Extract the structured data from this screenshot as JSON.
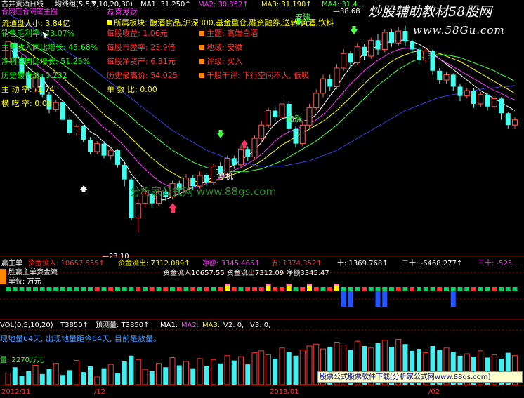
{
  "colors": {
    "bg": "#000000",
    "up": "#ff5a5a",
    "down": "#44ffee",
    "ma1": "#ffffff",
    "ma2": "#ff33ff",
    "ma3": "#ffff00",
    "ma4": "#44ff44",
    "ma5": "#3a3ad8",
    "panel_red": "#ff3030",
    "yellow": "#ffff00",
    "green": "#00ff00",
    "magenta": "#ff33ff",
    "cyan": "#44ffee",
    "white": "#ffffff",
    "bar_green": "#11cc66",
    "bar_red": "#ff3333",
    "bar_blue": "#2255ff",
    "bar_yellow": "#ffee00",
    "bar_pink": "#ff88bb",
    "vol_cyan": "#44eeee",
    "vol_red": "#ff3333"
  },
  "header": {
    "title": "古井贡酒日线",
    "indicator": "均线组(5,5,7,10,20,30)",
    "ma1": "MA1: 31.250↑",
    "ma2": "MA2: 30.852↑",
    "ma3": "MA3: 31.190↑",
    "ma4": "MA4: 31.4..."
  },
  "watermark": {
    "title": "炒股辅助教材58股网",
    "url": "www.58Gu.com",
    "center": "分析家公式网 www.88gs.com",
    "ad": "股票公式股票软件下载[分析家公式网www.88gs.com]"
  },
  "info_left": [
    {
      "label": "合网旺合鸡密主图",
      "color": "magenta"
    },
    {
      "label": "流通盘大小: 3.84亿",
      "color": "yellow"
    },
    {
      "label": "销售毛利率: 73.07%",
      "color": "green"
    },
    {
      "label": "主营收入同比增长: 45.68%",
      "color": "green"
    },
    {
      "label": "净利润同比增长: 51.25%",
      "color": "green"
    },
    {
      "label": "历史最低价: 0.232",
      "color": "green"
    },
    {
      "label": "主 动 率: -1.74",
      "color": "yellow"
    },
    {
      "label": "横 吃 率: 0.00",
      "color": "yellow"
    }
  ],
  "info_mid": [
    {
      "label": "恭喜发财",
      "color": "magenta"
    },
    {
      "label": "所属板块: 酿酒食品,沪深300,基金重仓,融资融券,送转,黄酒,饮料",
      "color": "yellow"
    },
    {
      "label": "每股收益: 1.06元",
      "color": "panel_red"
    },
    {
      "label": "每股市盈率: 23.9倍",
      "color": "panel_red"
    },
    {
      "label": "每股净资产: 6.31元",
      "color": "panel_red"
    },
    {
      "label": "历史最高价: 54.025",
      "color": "panel_red"
    },
    {
      "label": "单 数 比: 0.00",
      "color": "yellow"
    }
  ],
  "info_right": [
    {
      "label": "主题: 高端白酒",
      "color": "panel_red"
    },
    {
      "label": "地域: 安徽",
      "color": "panel_red"
    },
    {
      "label": "评级: 买入",
      "color": "panel_red"
    },
    {
      "label": "千股千评: 下行空间不大, 低吸",
      "color": "panel_red"
    }
  ],
  "annotations": {
    "high": "38.68",
    "low": "23.10",
    "anjian": "安建",
    "seek": "寻机",
    "chase": "追涨"
  },
  "chart_data": {
    "type": "candlestick",
    "ylim": [
      22,
      40
    ],
    "high_label": 38.68,
    "low_label": 23.1,
    "candles": [
      [
        36.0,
        37.5,
        35.8,
        37.8
      ],
      [
        37.4,
        36.3,
        36.0,
        37.6
      ],
      [
        36.3,
        35.1,
        34.9,
        36.5
      ],
      [
        35.1,
        34.0,
        33.8,
        35.3
      ],
      [
        34.0,
        34.8,
        33.7,
        35.0
      ],
      [
        34.8,
        33.5,
        33.3,
        35.0
      ],
      [
        33.5,
        32.4,
        32.1,
        33.7
      ],
      [
        32.4,
        32.9,
        32.2,
        33.1
      ],
      [
        32.9,
        31.6,
        31.4,
        33.0
      ],
      [
        31.6,
        30.6,
        30.4,
        31.8
      ],
      [
        30.6,
        31.1,
        30.4,
        31.3
      ],
      [
        31.1,
        30.1,
        29.9,
        31.2
      ],
      [
        30.1,
        29.2,
        29.0,
        30.3
      ],
      [
        29.2,
        29.8,
        29.0,
        30.0
      ],
      [
        29.8,
        28.9,
        28.7,
        30.0
      ],
      [
        28.9,
        29.3,
        28.6,
        29.5
      ],
      [
        29.3,
        28.2,
        28.0,
        29.4
      ],
      [
        28.2,
        27.1,
        26.6,
        28.4
      ],
      [
        27.1,
        24.2,
        24.0,
        27.2
      ],
      [
        24.2,
        25.3,
        23.1,
        25.6
      ],
      [
        25.3,
        26.0,
        25.0,
        26.2
      ],
      [
        26.0,
        25.3,
        25.0,
        26.2
      ],
      [
        25.3,
        26.2,
        25.1,
        26.5
      ],
      [
        26.2,
        25.8,
        25.5,
        26.4
      ],
      [
        25.8,
        26.8,
        25.6,
        27.0
      ],
      [
        26.8,
        26.3,
        26.0,
        27.0
      ],
      [
        26.3,
        27.2,
        26.1,
        27.5
      ],
      [
        27.2,
        26.6,
        26.3,
        27.4
      ],
      [
        26.6,
        27.4,
        26.4,
        27.7
      ],
      [
        27.4,
        26.9,
        26.6,
        27.6
      ],
      [
        26.9,
        28.1,
        26.7,
        28.3
      ],
      [
        28.1,
        27.5,
        27.2,
        28.4
      ],
      [
        27.5,
        28.7,
        27.3,
        28.9
      ],
      [
        28.7,
        28.2,
        27.9,
        28.9
      ],
      [
        28.2,
        29.4,
        28.0,
        29.7
      ],
      [
        29.4,
        28.8,
        28.5,
        29.6
      ],
      [
        28.8,
        30.2,
        28.6,
        30.4
      ],
      [
        30.2,
        31.2,
        30.0,
        31.5
      ],
      [
        31.2,
        32.3,
        31.0,
        32.5
      ],
      [
        32.3,
        31.8,
        31.5,
        32.6
      ],
      [
        31.8,
        32.8,
        31.6,
        33.1
      ],
      [
        32.8,
        30.9,
        30.6,
        33.0
      ],
      [
        30.9,
        29.8,
        29.5,
        31.1
      ],
      [
        29.8,
        31.2,
        29.6,
        31.5
      ],
      [
        31.2,
        32.5,
        31.0,
        32.8
      ],
      [
        32.5,
        33.6,
        32.3,
        33.9
      ],
      [
        33.6,
        34.7,
        33.3,
        35.0
      ],
      [
        34.7,
        34.1,
        33.8,
        35.0
      ],
      [
        34.1,
        35.5,
        33.9,
        35.8
      ],
      [
        35.5,
        36.6,
        35.3,
        36.9
      ],
      [
        36.6,
        35.9,
        35.6,
        36.8
      ],
      [
        35.9,
        37.1,
        35.7,
        37.4
      ],
      [
        37.1,
        36.4,
        36.1,
        37.3
      ],
      [
        36.4,
        37.6,
        36.2,
        37.8
      ],
      [
        37.6,
        36.9,
        36.5,
        38.1
      ],
      [
        36.9,
        38.2,
        36.7,
        38.4
      ],
      [
        38.2,
        37.4,
        37.1,
        38.4
      ],
      [
        37.4,
        38.3,
        37.2,
        38.6
      ],
      [
        38.3,
        37.5,
        37.2,
        38.68
      ],
      [
        37.5,
        36.9,
        36.6,
        37.7
      ],
      [
        36.9,
        36.1,
        35.8,
        37.1
      ],
      [
        36.1,
        36.8,
        35.9,
        37.0
      ],
      [
        36.8,
        35.3,
        35.0,
        36.9
      ],
      [
        35.3,
        34.6,
        34.3,
        35.5
      ],
      [
        34.6,
        35.0,
        34.3,
        35.2
      ],
      [
        35.0,
        34.1,
        33.8,
        35.1
      ],
      [
        34.1,
        33.4,
        33.0,
        34.3
      ],
      [
        33.4,
        33.8,
        33.2,
        34.0
      ],
      [
        33.8,
        32.8,
        32.5,
        34.0
      ],
      [
        32.8,
        33.5,
        32.6,
        33.7
      ],
      [
        33.5,
        32.6,
        32.3,
        33.6
      ],
      [
        32.6,
        33.2,
        32.4,
        33.4
      ],
      [
        33.2,
        32.1,
        31.6,
        33.3
      ],
      [
        32.1,
        31.2,
        30.9,
        32.2
      ],
      [
        31.2,
        31.6,
        30.9,
        31.8
      ]
    ],
    "ma_lines": [
      {
        "name": "MA1",
        "color": "ma1",
        "values": [
          37.0,
          36.6,
          36.1,
          35.5,
          35.1,
          34.7,
          34.0,
          33.5,
          33.0,
          32.4,
          31.9,
          31.3,
          30.7,
          30.4,
          29.9,
          29.5,
          29.0,
          28.4,
          27.5,
          26.9,
          26.3,
          25.8,
          25.5,
          25.6,
          25.8,
          26.0,
          26.3,
          26.5,
          26.8,
          27.0,
          27.3,
          27.6,
          27.9,
          28.2,
          28.6,
          28.9,
          29.3,
          29.9,
          30.7,
          31.3,
          31.7,
          31.8,
          31.7,
          31.5,
          31.6,
          32.0,
          32.7,
          33.4,
          34.1,
          34.9,
          35.6,
          36.1,
          36.6,
          36.9,
          37.2,
          37.4,
          37.5,
          37.6,
          37.6,
          37.5,
          37.3,
          37.0,
          36.6,
          36.2,
          35.8,
          35.4,
          35.0,
          34.6,
          34.2,
          33.8,
          33.5,
          33.2,
          32.9,
          32.6,
          32.3
        ]
      },
      {
        "name": "MA2",
        "color": "ma2",
        "values": [
          37.3,
          37.0,
          36.6,
          36.2,
          35.8,
          35.4,
          35.0,
          34.5,
          34.0,
          33.5,
          33.0,
          32.5,
          32.0,
          31.5,
          31.0,
          30.6,
          30.1,
          29.6,
          29.0,
          28.4,
          27.9,
          27.4,
          27.0,
          26.7,
          26.5,
          26.4,
          26.4,
          26.5,
          26.6,
          26.8,
          27.0,
          27.2,
          27.5,
          27.8,
          28.0,
          28.3,
          28.6,
          29.0,
          29.5,
          30.0,
          30.4,
          30.7,
          30.9,
          31.1,
          31.3,
          31.6,
          32.0,
          32.5,
          33.1,
          33.7,
          34.3,
          34.8,
          35.3,
          35.7,
          36.1,
          36.4,
          36.7,
          36.9,
          37.0,
          37.0,
          36.9,
          36.7,
          36.5,
          36.2,
          35.9,
          35.6,
          35.3,
          35.0,
          34.7,
          34.4,
          34.1,
          33.8,
          33.6,
          33.3,
          33.1
        ]
      },
      {
        "name": "MA3",
        "color": "ma3",
        "values": [
          37.5,
          37.3,
          37.0,
          36.7,
          36.3,
          36.0,
          35.6,
          35.2,
          34.8,
          34.3,
          33.9,
          33.4,
          33.0,
          32.5,
          32.0,
          31.6,
          31.2,
          30.7,
          30.2,
          29.7,
          29.2,
          28.7,
          28.3,
          27.9,
          27.6,
          27.3,
          27.1,
          27.0,
          26.9,
          26.9,
          27.0,
          27.1,
          27.3,
          27.5,
          27.7,
          27.9,
          28.2,
          28.5,
          28.9,
          29.3,
          29.7,
          30.0,
          30.3,
          30.6,
          30.9,
          31.2,
          31.5,
          31.9,
          32.3,
          32.8,
          33.3,
          33.8,
          34.3,
          34.8,
          35.2,
          35.6,
          36.0,
          36.3,
          36.5,
          36.7,
          36.8,
          36.8,
          36.7,
          36.6,
          36.4,
          36.2,
          36.0,
          35.7,
          35.4,
          35.1,
          34.8,
          34.5,
          34.2,
          33.9,
          33.6
        ]
      },
      {
        "name": "MA4",
        "color": "ma4",
        "values": [
          38.2,
          38.0,
          37.7,
          37.4,
          37.1,
          36.8,
          36.5,
          36.1,
          35.8,
          35.4,
          35.0,
          34.6,
          34.2,
          33.8,
          33.4,
          33.0,
          32.6,
          32.2,
          31.8,
          31.3,
          30.9,
          30.5,
          30.1,
          29.7,
          29.3,
          29.0,
          28.7,
          28.4,
          28.2,
          28.0,
          27.9,
          27.8,
          27.7,
          27.7,
          27.7,
          27.7,
          27.8,
          27.9,
          28.1,
          28.3,
          28.5,
          28.8,
          29.1,
          29.4,
          29.7,
          30.0,
          30.4,
          30.8,
          31.2,
          31.7,
          32.2,
          32.7,
          33.2,
          33.7,
          34.2,
          34.6,
          35.0,
          35.4,
          35.7,
          36.0,
          36.2,
          36.4,
          36.5,
          36.5,
          36.5,
          36.4,
          36.3,
          36.1,
          35.9,
          35.7,
          35.5,
          35.3,
          35.0,
          34.8,
          34.5
        ]
      },
      {
        "name": "MA5",
        "color": "ma5",
        "values": [
          39.6,
          39.3,
          39.0,
          38.7,
          38.4,
          38.0,
          37.7,
          37.3,
          37.0,
          36.6,
          36.3,
          35.9,
          35.6,
          35.2,
          34.8,
          34.4,
          34.0,
          33.6,
          33.2,
          32.8,
          32.4,
          32.0,
          31.6,
          31.2,
          30.8,
          30.5,
          30.2,
          29.9,
          29.6,
          29.3,
          29.1,
          28.9,
          28.7,
          28.5,
          28.4,
          28.3,
          28.2,
          28.1,
          28.1,
          28.1,
          28.1,
          28.2,
          28.3,
          28.4,
          28.5,
          28.7,
          28.9,
          29.1,
          29.3,
          29.6,
          29.9,
          30.2,
          30.5,
          30.8,
          31.1,
          31.4,
          31.7,
          32.0,
          32.3,
          32.5,
          32.7,
          32.9,
          33.1,
          33.3,
          33.4,
          33.5,
          33.6,
          33.7,
          33.8,
          33.9,
          34.0,
          34.0,
          34.1,
          34.1,
          34.2
        ]
      }
    ],
    "flow_bars": [
      [
        "g",
        0,
        0
      ],
      [
        "g",
        0,
        0
      ],
      [
        "g",
        0,
        0
      ],
      [
        "g",
        0,
        0
      ],
      [
        "g",
        0,
        0
      ],
      [
        "g",
        0,
        0
      ],
      [
        "g",
        0,
        0
      ],
      [
        "g",
        0,
        0
      ],
      [
        "g",
        0,
        0
      ],
      [
        "g",
        0,
        0
      ],
      [
        "g",
        0,
        0
      ],
      [
        "g",
        0,
        0
      ],
      [
        "g",
        0,
        0
      ],
      [
        "r",
        0,
        0
      ],
      [
        "g",
        0,
        0
      ],
      [
        "r",
        0,
        0
      ],
      [
        "g",
        0,
        0
      ],
      [
        "g",
        0,
        0
      ],
      [
        "g",
        0,
        0
      ],
      [
        "r",
        0,
        0
      ],
      [
        "g",
        0,
        0
      ],
      [
        "r",
        0,
        0
      ],
      [
        "g",
        0,
        0
      ],
      [
        "r",
        0,
        0
      ],
      [
        "g",
        0,
        0
      ],
      [
        "r",
        0,
        0
      ],
      [
        "g",
        0,
        0
      ],
      [
        "r",
        0,
        0
      ],
      [
        "g",
        0,
        0
      ],
      [
        "r",
        0,
        0
      ],
      [
        "g",
        0,
        0
      ],
      [
        "r",
        0,
        0
      ],
      [
        "y",
        1,
        0
      ],
      [
        "r",
        0,
        0
      ],
      [
        "g",
        0,
        0
      ],
      [
        "r",
        0,
        0
      ],
      [
        "r",
        0,
        0
      ],
      [
        "r",
        0,
        0
      ],
      [
        "y",
        1,
        0
      ],
      [
        "r",
        0,
        0
      ],
      [
        "r",
        0,
        0
      ],
      [
        "y",
        1,
        0
      ],
      [
        "g",
        0,
        0
      ],
      [
        "r",
        0,
        0
      ],
      [
        "y",
        1,
        0
      ],
      [
        "r",
        0,
        0
      ],
      [
        "g",
        0,
        0
      ],
      [
        "r",
        0,
        0
      ],
      [
        "y",
        1,
        0
      ],
      [
        "g",
        0,
        1
      ],
      [
        "g",
        0,
        1
      ],
      [
        "g",
        0,
        0
      ],
      [
        "r",
        0,
        0
      ],
      [
        "g",
        0,
        0
      ],
      [
        "g",
        0,
        1
      ],
      [
        "g",
        0,
        1
      ],
      [
        "g",
        0,
        0
      ],
      [
        "r",
        0,
        0
      ],
      [
        "g",
        0,
        0
      ],
      [
        "r",
        0,
        0
      ],
      [
        "g",
        0,
        0
      ],
      [
        "g",
        0,
        0
      ],
      [
        "g",
        0,
        0
      ],
      [
        "r",
        0,
        0
      ],
      [
        "g",
        0,
        0
      ],
      [
        "g",
        0,
        1
      ],
      [
        "g",
        0,
        0
      ],
      [
        "g",
        0,
        0
      ],
      [
        "r",
        0,
        0
      ],
      [
        "g",
        0,
        0
      ],
      [
        "g",
        0,
        0
      ],
      [
        "r",
        0,
        0
      ],
      [
        "g",
        0,
        0
      ],
      [
        "g",
        0,
        0
      ],
      [
        "g",
        0,
        0
      ]
    ],
    "volume": [
      12,
      18,
      9,
      14,
      20,
      11,
      16,
      22,
      10,
      15,
      25,
      13,
      19,
      8,
      17,
      21,
      12,
      24,
      30,
      26,
      16,
      14,
      22,
      18,
      28,
      20,
      24,
      17,
      27,
      19,
      26,
      22,
      30,
      25,
      29,
      21,
      33,
      35,
      31,
      27,
      38,
      34,
      30,
      36,
      40,
      42,
      37,
      39,
      44,
      41,
      36,
      45,
      40,
      38,
      43,
      46,
      39,
      47,
      42,
      35,
      37,
      33,
      40,
      36,
      38,
      34,
      30,
      32,
      29,
      35,
      28,
      31,
      27,
      33,
      30
    ]
  },
  "flow_header": {
    "name": "赢主单",
    "inflow": "资金流入: 10657.555↑",
    "outflow": "资金流出: 7312.089↑",
    "net": "净额: 3345.465↑",
    "five": "五: 1374.352↑",
    "ten": "十: 1369.768↑",
    "twenty": "二十: -6468.277↑",
    "thirty": "三十: -525..."
  },
  "flow_sub": {
    "title": "胜赢主单资金流",
    "unit": "单位: 万元",
    "summary": "资金流入10657.55 资金流出7312.09 净额3345.47"
  },
  "vol_header": {
    "name": "VOL(0,5,10,20)",
    "value": "T3850↑",
    "forecast": "预测量: T3850↑",
    "ma1": "MA1:",
    "ma2": "MA2:",
    "ma3": "MA3:",
    "v2": "V2: 0,",
    "v3": "V3: 0,",
    "desc": "现地量64天, 出现地量距今64天, 目前是放量。",
    "base": "量: 2270万元"
  },
  "dates": [
    "2012/11",
    "/12",
    "2013/01",
    "/02"
  ]
}
